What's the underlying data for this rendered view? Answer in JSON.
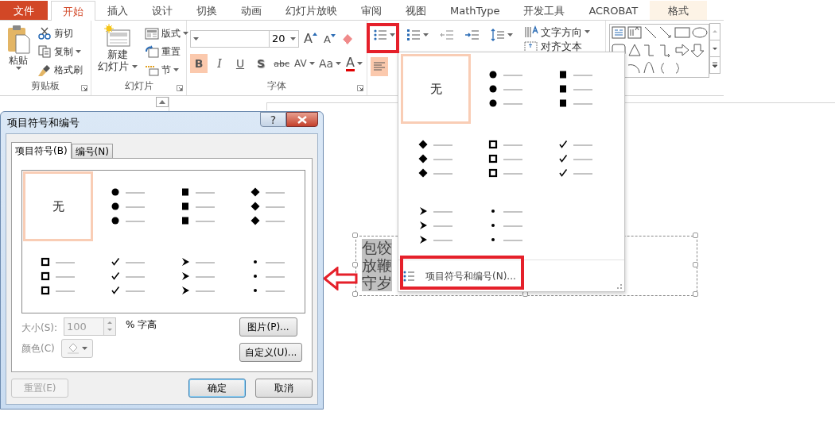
{
  "ribbon_tabs": [
    {
      "label": "文件",
      "kind": "file",
      "selected": false
    },
    {
      "label": "开始",
      "kind": "normal",
      "selected": true
    },
    {
      "label": "插入",
      "kind": "normal",
      "selected": false
    },
    {
      "label": "设计",
      "kind": "normal",
      "selected": false
    },
    {
      "label": "切换",
      "kind": "normal",
      "selected": false
    },
    {
      "label": "动画",
      "kind": "normal",
      "selected": false
    },
    {
      "label": "幻灯片放映",
      "kind": "normal",
      "selected": false
    },
    {
      "label": "审阅",
      "kind": "normal",
      "selected": false
    },
    {
      "label": "视图",
      "kind": "normal",
      "selected": false
    },
    {
      "label": "MathType",
      "kind": "normal",
      "selected": false
    },
    {
      "label": "开发工具",
      "kind": "normal",
      "selected": false
    },
    {
      "label": "ACROBAT",
      "kind": "normal",
      "selected": false
    },
    {
      "label": "格式",
      "kind": "contextual",
      "selected": false
    }
  ],
  "clipboard": {
    "title": "剪贴板",
    "paste": "粘贴",
    "cut": "剪切",
    "copy": "复制",
    "format_painter": "格式刷"
  },
  "slides": {
    "title": "幻灯片",
    "new_slide": [
      "新建",
      "幻灯片"
    ],
    "layout": "版式",
    "reset": "重置",
    "section": "节"
  },
  "font": {
    "title": "字体",
    "font_size": "20",
    "grow_font": "A",
    "shrink_font": "A",
    "format_buttons": [
      {
        "kind": "bold",
        "label": "B",
        "on": true
      },
      {
        "kind": "italic",
        "label": "I",
        "on": false
      },
      {
        "kind": "underline",
        "label": "U",
        "on": false
      },
      {
        "kind": "shadow",
        "label": "S",
        "on": false
      },
      {
        "kind": "strike",
        "label": "abc",
        "on": false
      },
      {
        "kind": "spacing",
        "label": "AV",
        "on": false
      },
      {
        "kind": "case",
        "label": "Aa",
        "on": false
      },
      {
        "kind": "color",
        "label": "A",
        "on": false
      }
    ]
  },
  "paragraph": {
    "text_direction": "文字方向",
    "align_text": "对齐文本",
    "align_left_on": true
  },
  "slide_text": [
    "包饺",
    "放鞭",
    "守岁"
  ],
  "bullet_menu": {
    "options": [
      {
        "kind": "none",
        "label": "无",
        "selected": true
      },
      {
        "kind": "disc",
        "selected": false
      },
      {
        "kind": "square",
        "selected": false
      },
      {
        "kind": "diamond",
        "selected": false
      },
      {
        "kind": "hollow-square",
        "selected": false
      },
      {
        "kind": "check",
        "selected": false
      },
      {
        "kind": "arrow",
        "selected": false
      },
      {
        "kind": "dot",
        "selected": false
      }
    ],
    "command": "项目符号和编号(N)..."
  },
  "dialog": {
    "title": "项目符号和编号",
    "help": "?",
    "tabs": [
      {
        "label": "项目符号(B)",
        "selected": true
      },
      {
        "label": "编号(N)",
        "selected": false
      }
    ],
    "options": [
      {
        "kind": "none",
        "label": "无",
        "selected": true
      },
      {
        "kind": "disc",
        "selected": false
      },
      {
        "kind": "square",
        "selected": false
      },
      {
        "kind": "diamond",
        "selected": false
      },
      {
        "kind": "hollow-square",
        "selected": false
      },
      {
        "kind": "check",
        "selected": false
      },
      {
        "kind": "arrow",
        "selected": false
      },
      {
        "kind": "dot",
        "selected": false
      }
    ],
    "size_label": "大小(S):",
    "size_value": "100",
    "size_unit": "% 字高",
    "size_disabled": true,
    "color_label": "颜色(C)",
    "color_disabled": true,
    "picture_button": "图片(P)...",
    "customize_button": "自定义(U)...",
    "reset_button": {
      "label": "重置(E)",
      "disabled": true
    },
    "ok_button": "确定",
    "cancel_button": "取消"
  }
}
